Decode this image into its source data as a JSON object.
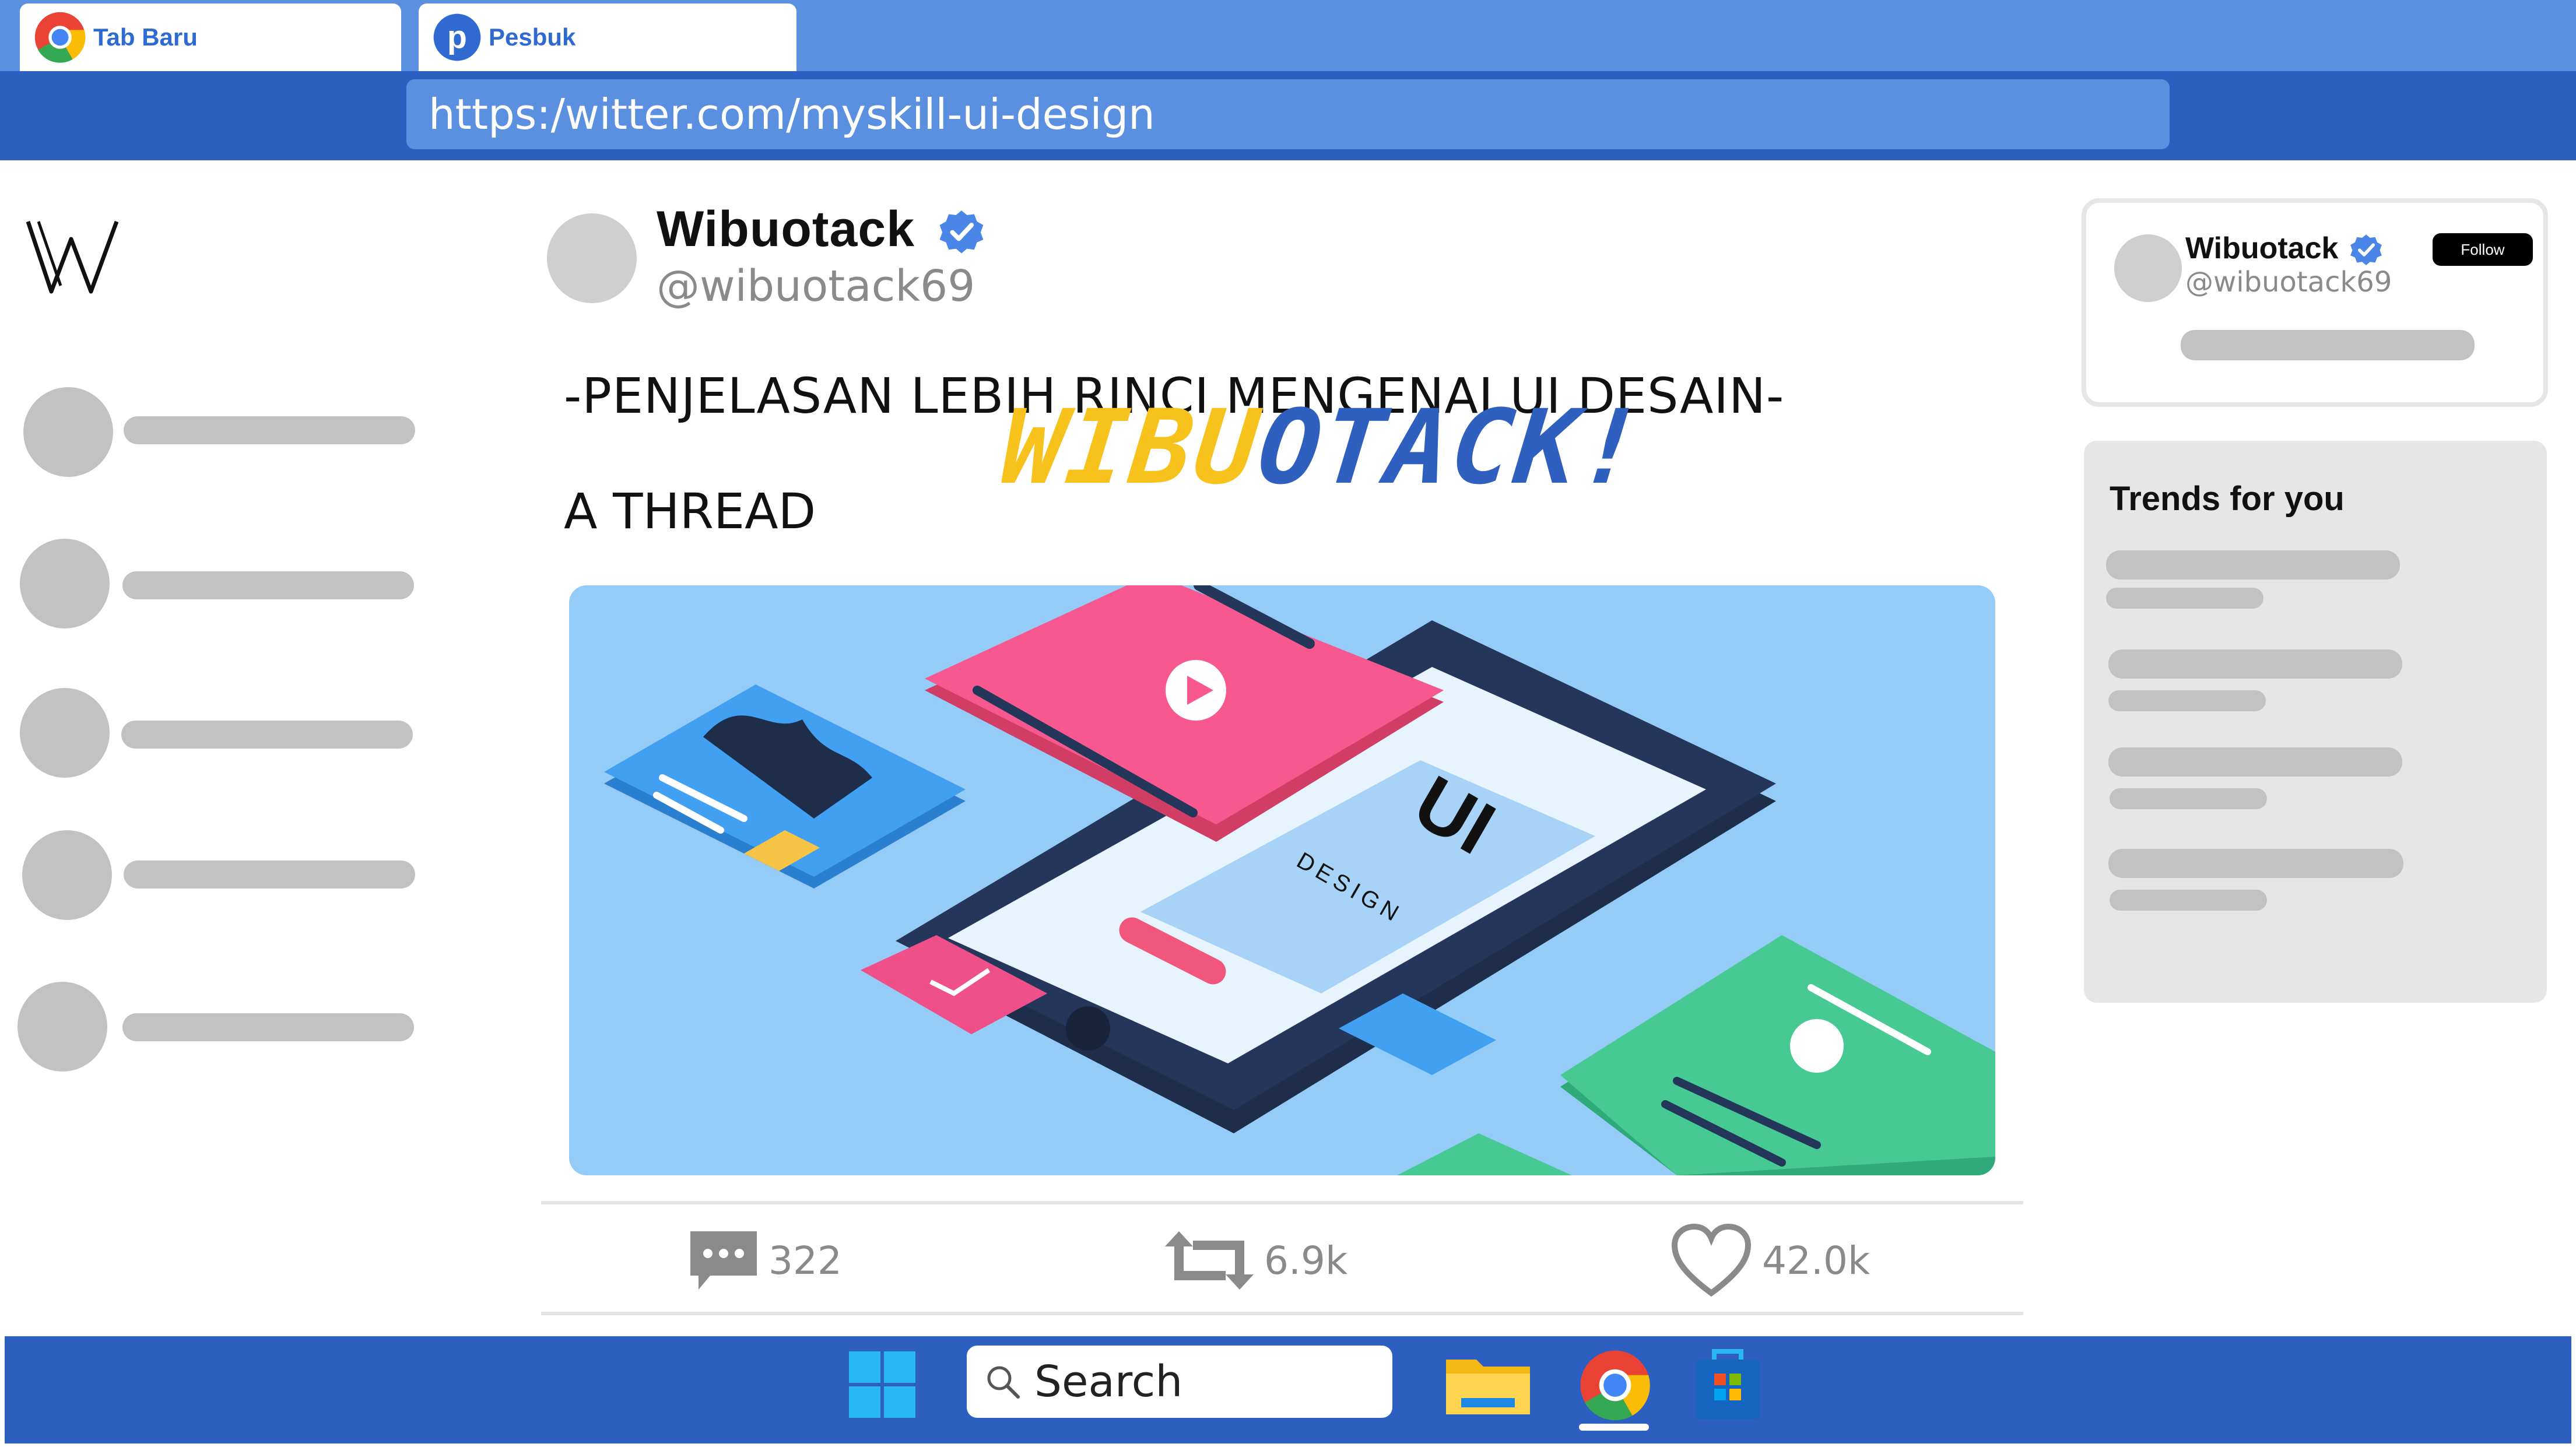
{
  "browser": {
    "tabs": [
      {
        "label": "Tab Baru",
        "icon": "chrome-icon"
      },
      {
        "label": "Pesbuk",
        "icon": "pesbuk-icon"
      }
    ],
    "address": "https:/witter.com/myskill-ui-design"
  },
  "sidebar": {
    "logo": "W"
  },
  "tweet": {
    "name": "Wibuotack",
    "handle": "@wibuotack69",
    "text_line1": "-PENJELASAN LEBIH RINCI MENGENAI UI DESAIN-",
    "text_line2": "A THREAD",
    "watermark_part1": "WIBU",
    "watermark_part2": "OTACK!",
    "image_text": {
      "ui": "UI",
      "design": "DESIGN"
    },
    "actions": {
      "replies": "322",
      "retweets": "6.9k",
      "likes": "42.0k"
    }
  },
  "profile_card": {
    "name": "Wibuotack",
    "handle": "@wibuotack69",
    "follow_label": "Follow"
  },
  "trends": {
    "title": "Trends for you"
  },
  "taskbar": {
    "search_label": "Search"
  },
  "colors": {
    "tabbar": "#5b8fe0",
    "chrome_blue": "#2c5fbf",
    "verified": "#4a86e8",
    "placeholder_gray": "#c2c2c2",
    "watermark_yellow": "#f7c21b",
    "watermark_blue": "#2f5fbf"
  }
}
